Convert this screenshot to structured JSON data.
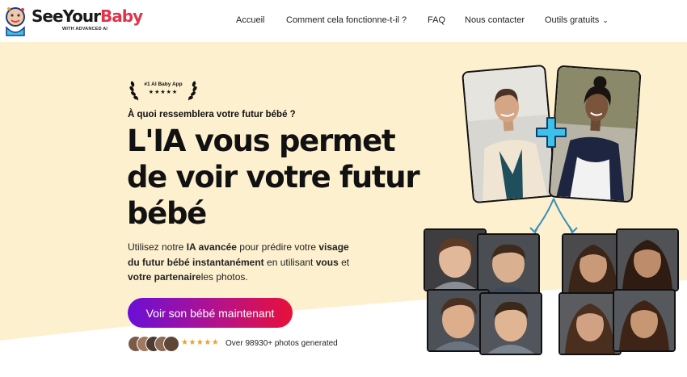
{
  "logo": {
    "brand_part1": "SeeYour",
    "brand_part2": "Baby",
    "tagline": "WITH ADVANCED AI"
  },
  "nav": {
    "items": [
      "Accueil",
      "Comment cela fonctionne-t-il ?",
      "FAQ",
      "Nous contacter",
      "Outils gratuits"
    ],
    "dropdown_icon": "chevron-down-icon"
  },
  "hero": {
    "badge_text": "#1 AI Baby App",
    "badge_stars": "★★★★★",
    "question": "À quoi ressemblera votre futur bébé ?",
    "headline": "L'IA vous permet de voir votre futur bébé",
    "description": {
      "p1": "Utilisez notre ",
      "b1": "IA avancée",
      "p2": " pour prédire votre ",
      "b2": "visage du futur bébé instantanément",
      "p3": " en utilisant ",
      "b3": "vous",
      "p4": " et ",
      "b4": "votre partenaire",
      "p5": "les photos."
    },
    "cta_label": "Voir son bébé maintenant",
    "proof_stars": "★★★★★",
    "proof_text": "Over 98930+ photos generated"
  },
  "colors": {
    "background": "#fdf0cf",
    "brand_red": "#e0344b",
    "cta_start": "#6a0fd8",
    "cta_end": "#e8103a",
    "plus_blue": "#3ec1e8"
  }
}
